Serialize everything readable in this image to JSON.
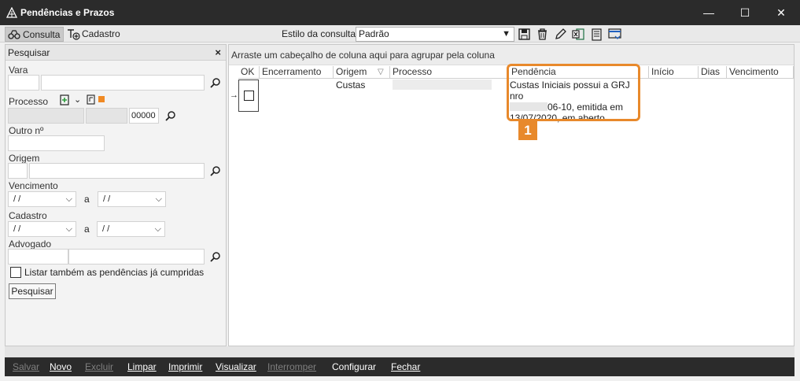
{
  "window": {
    "title": "Pendências e Prazos",
    "min_glyph": "—",
    "max_glyph": "☐",
    "close_glyph": "✕"
  },
  "tabs": [
    {
      "label": "Consulta",
      "icon": "binoculars-icon"
    },
    {
      "label": "Cadastro",
      "icon": "text-add-icon"
    }
  ],
  "estilo": {
    "label": "Estilo da consulta",
    "value": "Padrão"
  },
  "toolbar_icons": [
    "save-icon",
    "delete-icon",
    "edit-icon",
    "excel-icon",
    "report-icon",
    "layout-icon"
  ],
  "search_panel": {
    "header": "Pesquisar",
    "close_glyph": "×",
    "vara_label": "Vara",
    "processo_label": "Processo",
    "processo_suffix": "00000",
    "outro_label": "Outro nº",
    "origem_label": "Origem",
    "vencimento_label": "Vencimento",
    "cadastro_label": "Cadastro",
    "advogado_label": "Advogado",
    "date_placeholder": " / /",
    "range_sep": "a",
    "list_cumpridas_label": "Listar também as pendências já cumpridas",
    "pesquisar_button": "Pesquisar"
  },
  "grid": {
    "group_hint": "Arraste um cabeçalho de coluna aqui para agrupar pela coluna",
    "columns": [
      "OK",
      "Encerramento",
      "Origem",
      "Processo",
      "Pendência",
      "Início",
      "Dias",
      "Vencimento"
    ],
    "row": {
      "origem": "Custas",
      "pendencia_line1": "Custas Iniciais possui a GRJ nro",
      "pendencia_line2": "06-10, emitida em",
      "pendencia_line3": "13/07/2020, em aberto"
    },
    "annotation_badge": "1",
    "highlight_color": "#e8892b"
  },
  "bottom_actions": [
    {
      "label": "Salvar",
      "enabled": false
    },
    {
      "label": "Novo",
      "enabled": true
    },
    {
      "label": "Excluir",
      "enabled": false
    },
    {
      "label": "Limpar",
      "enabled": true
    },
    {
      "label": "Imprimir",
      "enabled": true
    },
    {
      "label": "Visualizar",
      "enabled": true
    },
    {
      "label": "Interromper",
      "enabled": false
    },
    {
      "label": "Configurar",
      "enabled": true
    },
    {
      "label": "Fechar",
      "enabled": true
    }
  ]
}
